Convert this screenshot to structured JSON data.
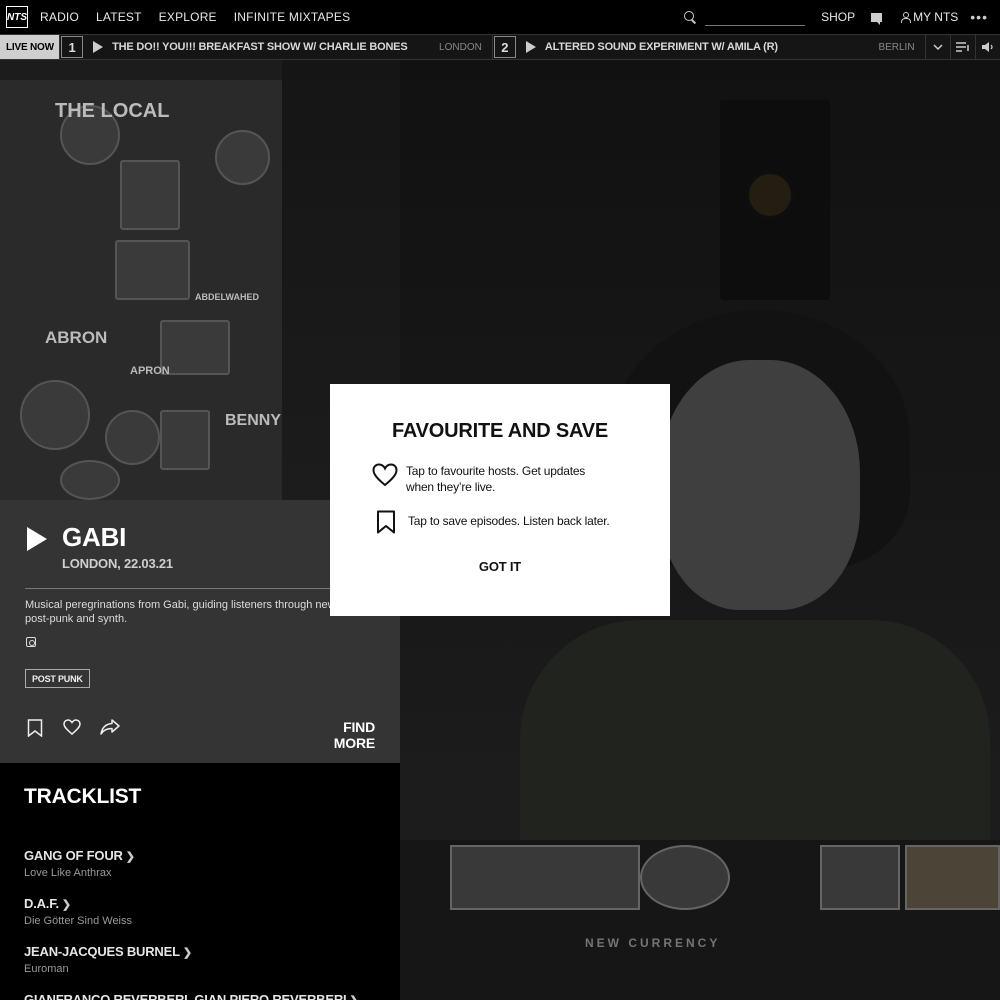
{
  "nav": {
    "logo": "NTS",
    "links": [
      "RADIO",
      "LATEST",
      "EXPLORE",
      "INFINITE MIXTAPES"
    ],
    "search_placeholder": "",
    "shop": "SHOP",
    "my_nts": "MY NTS",
    "more": "•••"
  },
  "livebar": {
    "label": "LIVE NOW",
    "channels": [
      {
        "number": "1",
        "title": "THE DO!! YOU!!! BREAKFAST SHOW W/ CHARLIE BONES",
        "location": "LONDON"
      },
      {
        "number": "2",
        "title": "ALTERED SOUND EXPERIMENT W/ AMILA (R)",
        "location": "BERLIN"
      }
    ]
  },
  "show": {
    "title": "GABI",
    "subtitle": "LONDON, 22.03.21",
    "description": "Musical peregrinations from Gabi, guiding listeners through new wave, post-punk and synth.",
    "tag": "POST PUNK",
    "find_more": "FIND MORE"
  },
  "hero": {
    "wall_texts": [
      "THE LOCAL",
      "ABRON",
      "ABDELWAHED",
      "BENNY",
      "APRON"
    ],
    "desk_text": "NEW CURRENCY"
  },
  "tracklist": {
    "heading": "TRACKLIST",
    "tracks": [
      {
        "artist": "GANG OF FOUR",
        "title": "Love Like Anthrax"
      },
      {
        "artist": "D.A.F.",
        "title": "Die Götter Sind Weiss"
      },
      {
        "artist": "JEAN-JACQUES BURNEL",
        "title": "Euroman"
      },
      {
        "artist": "GIANFRANCO REVERBERI, GIAN PIERO REVERBERI",
        "title": ""
      }
    ]
  },
  "modal": {
    "title": "FAVOURITE AND SAVE",
    "favourite_text": "Tap to favourite hosts. Get updates when they’re live.",
    "save_text": "Tap to save episodes. Listen back later.",
    "button": "GOT IT"
  }
}
